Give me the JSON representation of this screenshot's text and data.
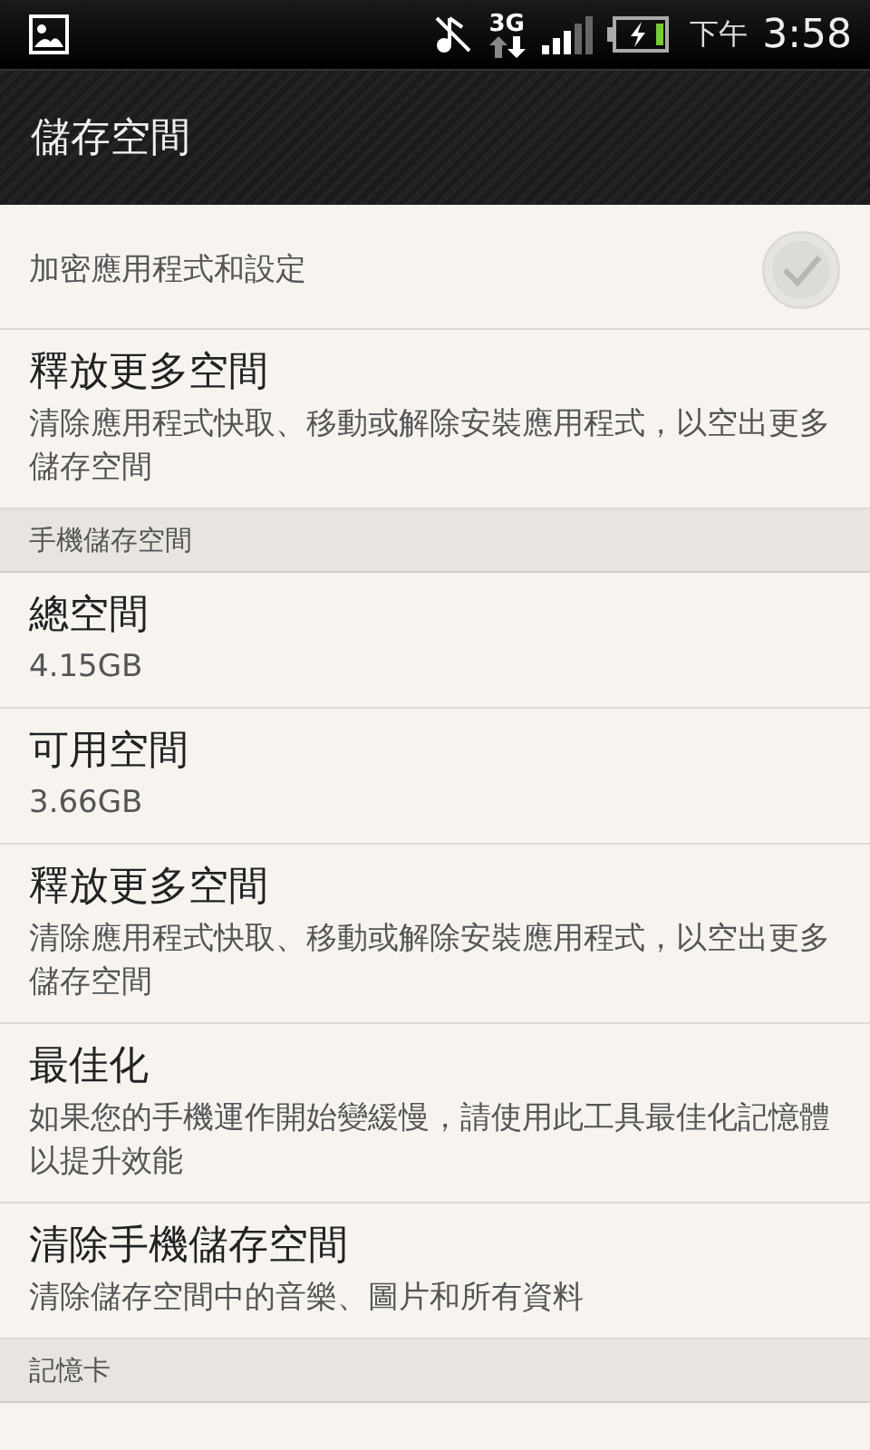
{
  "status_bar": {
    "time_prefix": "下午",
    "time": "3:58",
    "network": "3G"
  },
  "header": {
    "title": "儲存空間"
  },
  "sections": [
    {
      "items": [
        {
          "kind": "check",
          "subtitle": "加密應用程式和設定",
          "checked": true,
          "disabled": true
        },
        {
          "kind": "text",
          "title": "釋放更多空間",
          "subtitle": "清除應用程式快取、移動或解除安裝應用程式，以空出更多儲存空間"
        }
      ]
    },
    {
      "title": "手機儲存空間",
      "items": [
        {
          "kind": "text",
          "title": "總空間",
          "subtitle": "4.15GB"
        },
        {
          "kind": "text",
          "title": "可用空間",
          "subtitle": "3.66GB"
        },
        {
          "kind": "text",
          "title": "釋放更多空間",
          "subtitle": "清除應用程式快取、移動或解除安裝應用程式，以空出更多儲存空間"
        },
        {
          "kind": "text",
          "title": "最佳化",
          "subtitle": "如果您的手機運作開始變緩慢，請使用此工具最佳化記憶體以提升效能"
        },
        {
          "kind": "text",
          "title": "清除手機儲存空間",
          "subtitle": "清除儲存空間中的音樂、圖片和所有資料"
        }
      ]
    },
    {
      "title": "記憶卡"
    }
  ]
}
